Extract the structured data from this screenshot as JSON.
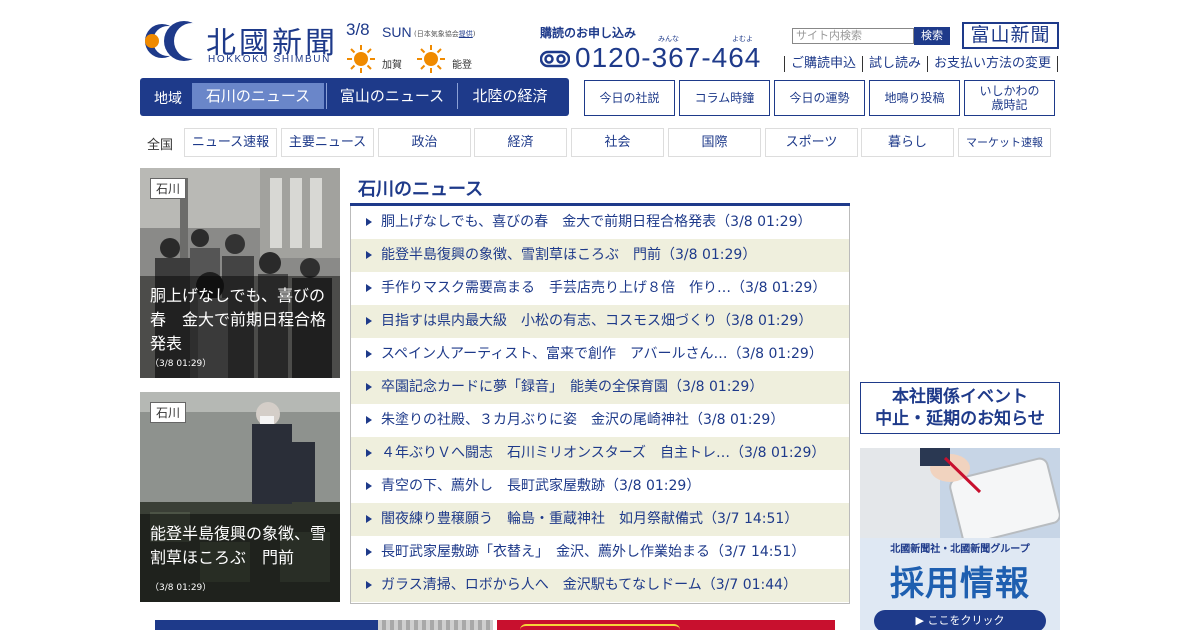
{
  "header": {
    "logo_title": "北國新聞",
    "logo_sub": "HOKKOKU SHIMBUN",
    "weather": {
      "date": "3/8",
      "day": "SUN",
      "source_prefix": "(日本気象協会",
      "source_link": "提供",
      "source_suffix": ")",
      "places": [
        "加賀",
        "能登"
      ],
      "icon": "sun-icon"
    },
    "subscribe": {
      "title": "購読のお申し込み",
      "ruby": [
        "みんな",
        "よむよ"
      ],
      "phone": "0120-367-464"
    },
    "search": {
      "placeholder": "サイト内検索",
      "button": "検索"
    },
    "toyama_link": "富山新聞",
    "util_links": [
      "ご購読申込",
      "試し読み",
      "お支払い方法の変更"
    ]
  },
  "region_nav": {
    "label": "地域",
    "tabs": [
      "石川のニュース",
      "富山のニュース",
      "北陸の経済"
    ],
    "active": 0
  },
  "section_buttons": [
    "今日の社説",
    "コラム時鐘",
    "今日の運勢",
    "地鳴り投稿",
    "いしかわの\n歳時記"
  ],
  "categories": {
    "all_label": "全国",
    "items": [
      "ニュース速報",
      "主要ニュース",
      "政治",
      "経済",
      "社会",
      "国際",
      "スポーツ",
      "暮らし",
      "マーケット速報"
    ]
  },
  "photos": [
    {
      "tag": "石川",
      "caption": "胴上げなしでも、喜びの春　金大で前期日程合格発表",
      "time": "（3/8 01:29）"
    },
    {
      "tag": "石川",
      "caption": "能登半島復興の象徴、雪割草ほころぶ　門前",
      "time": "（3/8 01:29）"
    }
  ],
  "news": {
    "heading": "石川のニュース",
    "items": [
      "胴上げなしでも、喜びの春　金大で前期日程合格発表（3/8 01:29）",
      "能登半島復興の象徴、雪割草ほころぶ　門前（3/8 01:29）",
      "手作りマスク需要高まる　手芸店売り上げ８倍　作り…（3/8 01:29）",
      "目指すは県内最大級　小松の有志、コスモス畑づくり（3/8 01:29）",
      "スペイン人アーティスト、富来で創作　アバールさん…（3/8 01:29）",
      "卒園記念カードに夢「録音」　能美の全保育園（3/8 01:29）",
      "朱塗りの社殿、３カ月ぶりに姿　金沢の尾崎神社（3/8 01:29）",
      "４年ぶりＶへ闘志　石川ミリオンスターズ　自主トレ…（3/8 01:29）",
      "青空の下、薦外し　長町武家屋敷跡（3/8 01:29）",
      "闇夜練り豊穣願う　輪島・重蔵神社　如月祭献備式（3/7 14:51）",
      "長町武家屋敷跡「衣替え」　金沢、薦外し作業始まる（3/7 14:51）",
      "ガラス清掃、ロボから人へ　金沢駅もてなしドーム（3/7 01:44）"
    ]
  },
  "banners": {
    "event_line1": "本社関係イベント",
    "event_line2": "中止・延期のお知らせ",
    "recruit_sub": "北國新聞社・北國新聞グループ",
    "recruit_main": "採用情報",
    "recruit_click": "▶ ここをクリック"
  },
  "colors": {
    "brand": "#1e3a8a",
    "alt_row": "#efefdd",
    "active_tab": "#6a86c9"
  }
}
